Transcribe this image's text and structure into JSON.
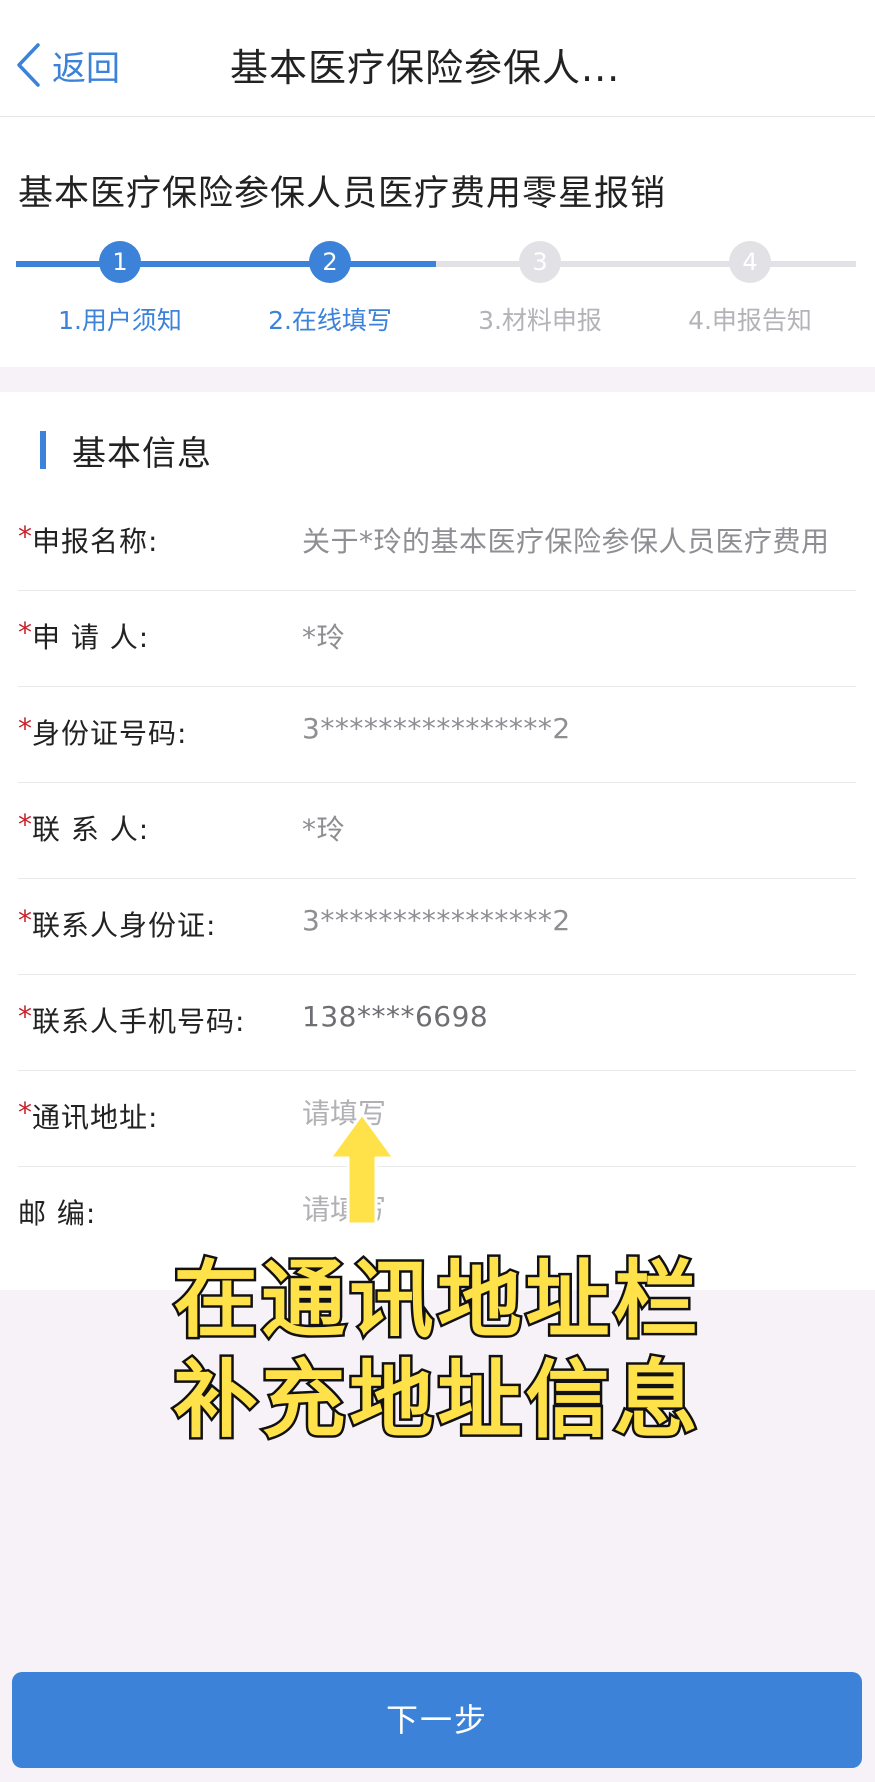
{
  "nav": {
    "back_label": "返回",
    "title": "基本医疗保险参保人..."
  },
  "form_title": "基本医疗保险参保人员医疗费用零星报销",
  "steps": [
    {
      "number": "1",
      "label": "1.用户须知",
      "status": "done"
    },
    {
      "number": "2",
      "label": "2.在线填写",
      "status": "current"
    },
    {
      "number": "3",
      "label": "3.材料申报",
      "status": "pending"
    },
    {
      "number": "4",
      "label": "4.申报告知",
      "status": "pending"
    }
  ],
  "section_title": "基本信息",
  "fields": [
    {
      "required": true,
      "label": "申报名称:",
      "value": "关于*玲的基本医疗保险参保人员医疗费用"
    },
    {
      "required": true,
      "label": "申 请 人:",
      "value": "*玲"
    },
    {
      "required": true,
      "label": "身份证号码:",
      "value": "3****************2"
    },
    {
      "required": true,
      "label": "联 系 人:",
      "value": "*玲"
    },
    {
      "required": true,
      "label": "联系人身份证:",
      "value": "3****************2"
    },
    {
      "required": true,
      "label": "联系人手机号码:",
      "value": "138****6698"
    },
    {
      "required": true,
      "label": "通讯地址:",
      "value": "",
      "placeholder": "请填写"
    },
    {
      "required": false,
      "label": "邮 编:",
      "value": "",
      "placeholder": "请填写"
    }
  ],
  "overlay": {
    "line1": "在通讯地址栏",
    "line2": "补充地址信息"
  },
  "next_button": "下一步",
  "colors": {
    "accent": "#3b82d8",
    "required": "#c8232c",
    "overlay_text": "#ffe14a"
  }
}
